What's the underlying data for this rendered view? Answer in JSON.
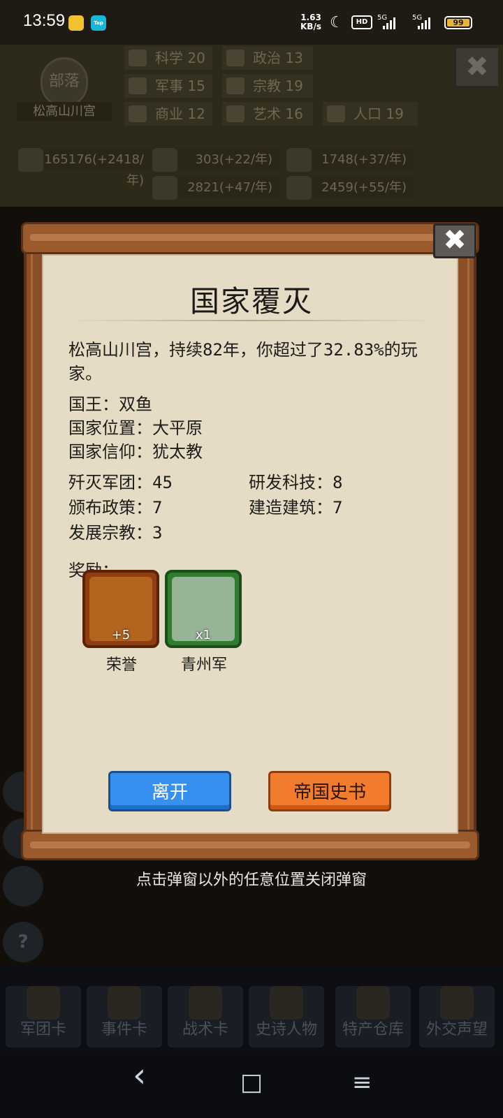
{
  "status_bar": {
    "time": "13:59",
    "app_tap": "Tap",
    "speed_value": "1.63",
    "speed_unit": "KB/s",
    "hd": "HD",
    "sim1": "5G",
    "sim2": "5G",
    "battery": "99"
  },
  "header": {
    "tribe_badge": "部落",
    "tribe_name": "松高山川宫",
    "stats": [
      {
        "label": "科学 20",
        "icon": "science-icon"
      },
      {
        "label": "政治 13",
        "icon": "politics-icon"
      },
      {
        "label": "军事 15",
        "icon": "military-icon"
      },
      {
        "label": "宗教 19",
        "icon": "religion-icon"
      },
      {
        "label": "商业 12",
        "icon": "commerce-icon"
      },
      {
        "label": "艺术 16",
        "icon": "art-icon"
      },
      {
        "label": "人口 19",
        "icon": "population-icon"
      }
    ],
    "resources": [
      {
        "label": "165176(+2418/年)",
        "icon": "gold-icon"
      },
      {
        "label": "303(+22/年)",
        "icon": "wood-icon"
      },
      {
        "label": "1748(+37/年)",
        "icon": "iron-icon"
      },
      {
        "label": "2821(+47/年)",
        "icon": "stone-icon"
      },
      {
        "label": "2459(+55/年)",
        "icon": "meat-icon"
      }
    ],
    "close_glyph": "✖"
  },
  "dialog": {
    "title": "国家覆灭",
    "summary": "松高山川宫，持续82年，你超过了32.83%的玩家。",
    "king": "国王：双鱼",
    "location": "国家位置：大平原",
    "faith": "国家信仰：犹太教",
    "legions_destroyed": "歼灭军团：45",
    "tech_researched": "研发科技：8",
    "policies": "颁布政策：7",
    "buildings": "建造建筑：7",
    "religions": "发展宗教：3",
    "rewards_label": "奖励：",
    "rewards": [
      {
        "name": "荣誉",
        "qty": "+5",
        "icon": "honor-medal-icon"
      },
      {
        "name": "青州军",
        "qty": "x1",
        "icon": "qingzhou-army-icon"
      }
    ],
    "leave_button": "离开",
    "history_button": "帝国史书",
    "close_glyph": "✖"
  },
  "hint": "点击弹窗以外的任意位置关闭弹窗",
  "bottom_cards": [
    "军团卡",
    "事件卡",
    "战术卡",
    "史诗人物",
    "特产仓库",
    "外交声望"
  ],
  "side_buttons": [
    "?"
  ],
  "nav": {
    "back": "‹",
    "home": "□",
    "menu": "≡"
  },
  "colors": {
    "parchment": "#e6dcc6",
    "frame_wood": "#8a4f27",
    "leave_button": "#3590ef",
    "history_button": "#f27c2b"
  }
}
